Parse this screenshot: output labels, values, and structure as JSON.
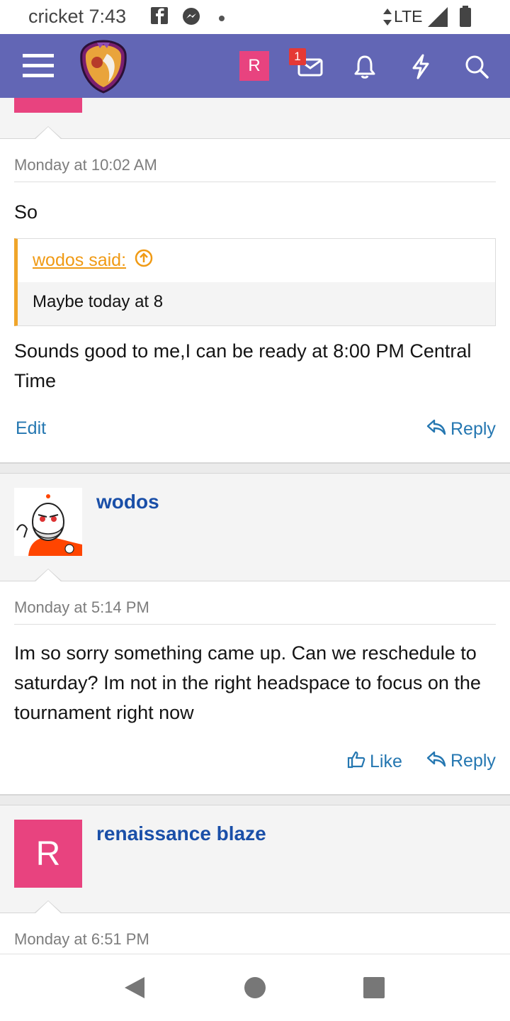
{
  "status_bar": {
    "carrier": "cricket",
    "time": "7:43",
    "network": "LTE"
  },
  "nav": {
    "user_initial": "R",
    "inbox_badge": "1",
    "accent": "#6266b5"
  },
  "posts": [
    {
      "date": "Monday at 10:02 AM",
      "text_before_quote": "So",
      "quote": {
        "author_link": "wodos said:",
        "body": "Maybe today at 8"
      },
      "text_after_quote": "Sounds good to me,I can be ready at 8:00 PM Central Time",
      "actions": {
        "edit": "Edit",
        "reply": "Reply"
      }
    },
    {
      "username": "wodos",
      "date": "Monday at 5:14 PM",
      "text": "Im so sorry something came up. Can we reschedule to saturday? Im not in the right headspace to focus on the tournament right now",
      "actions": {
        "like": "Like",
        "reply": "Reply"
      }
    },
    {
      "username": "renaissance blaze",
      "avatar_initial": "R",
      "date": "Monday at 6:51 PM"
    }
  ],
  "colors": {
    "link_blue": "#2577b1",
    "username_blue": "#1a4fa8",
    "quote_orange": "#f09a14",
    "avatar_pink": "#e8437f"
  }
}
